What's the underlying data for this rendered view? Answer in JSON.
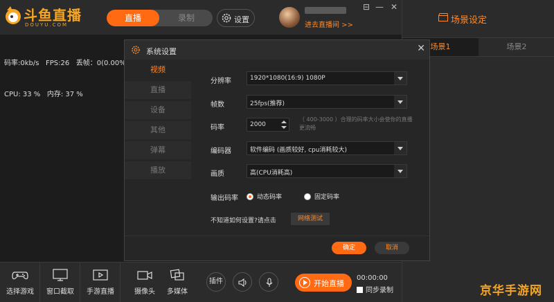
{
  "brand": {
    "name": "斗鱼直播",
    "sub": "DOUYU.COM"
  },
  "header": {
    "mode_live": "直播",
    "mode_record": "录制",
    "settings_label": "设置",
    "enter_room": "进去直播间 >>",
    "window": {
      "pin": "⊟",
      "minimize": "—",
      "close": "✕"
    }
  },
  "stats": {
    "line1": "码率:0kb/s   FPS:26   丢帧：0(0.00%)",
    "line2": "CPU: 33 %   内存: 37 %"
  },
  "scene": {
    "title": "场景设定",
    "tabs": [
      "场景1",
      "场景2"
    ]
  },
  "dialog": {
    "title": "系统设置",
    "close": "✕",
    "nav": [
      "视频",
      "直播",
      "设备",
      "其他",
      "弹幕",
      "播放"
    ],
    "resolution_label": "分辨率",
    "resolution_value": "1920*1080(16:9) 1080P",
    "fps_label": "帧数",
    "fps_value": "25fps(推荐)",
    "bitrate_label": "码率",
    "bitrate_value": "2000",
    "bitrate_hint": "（ 400-3000 ）合理的码率大小会使你的直播更流畅",
    "encoder_label": "编码器",
    "encoder_value": "软件编码 (画质较好, cpu消耗较大)",
    "quality_label": "画质",
    "quality_value": "高(CPU消耗高)",
    "output_label": "输出码率",
    "output_dynamic": "动态码率",
    "output_fixed": "固定码率",
    "help_text": "不知道如何设置?请点击",
    "net_test": "网络测试",
    "ok": "确定",
    "cancel": "取消"
  },
  "toolbar": {
    "tools": [
      "选择游戏",
      "窗口截取",
      "手游直播",
      "摄像头",
      "多媒体"
    ],
    "plugin": "插件",
    "start_live": "开始直播",
    "timer": "00:00:00",
    "sync_record": "同步录制"
  },
  "watermark": "京华手游网",
  "colors": {
    "accent": "#ff6a13",
    "brand": "#f6a623"
  }
}
